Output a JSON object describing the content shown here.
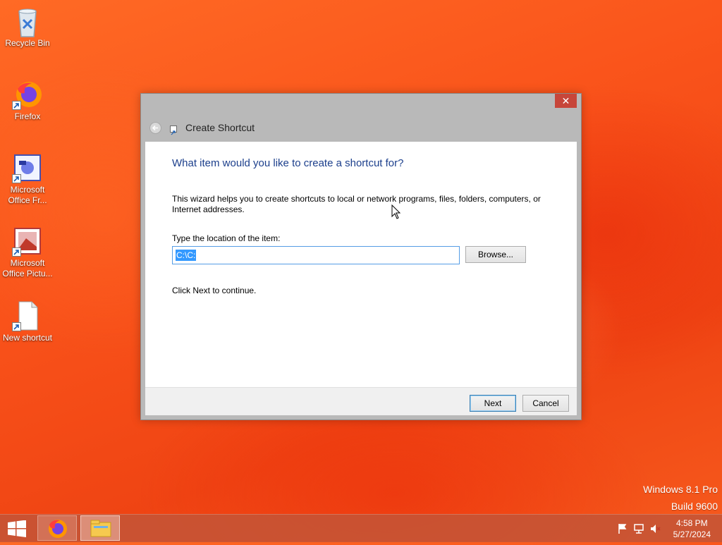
{
  "desktop": {
    "icons": [
      {
        "label": "Recycle Bin"
      },
      {
        "label": "Firefox"
      },
      {
        "label": "Microsoft Office Fr..."
      },
      {
        "label": "Microsoft Office Pictu..."
      },
      {
        "label": "New shortcut"
      }
    ]
  },
  "dialog": {
    "title": "Create Shortcut",
    "close_glyph": "✕",
    "heading": "What item would you like to create a shortcut for?",
    "description": "This wizard helps you to create shortcuts to local or network programs, files, folders, computers, or Internet addresses.",
    "location_label": "Type the location of the item:",
    "location_value": "C:\\C:",
    "browse_label": "Browse...",
    "continue_text": "Click Next to continue.",
    "next_label": "Next",
    "cancel_label": "Cancel"
  },
  "watermark": {
    "line1": "Windows 8.1 Pro",
    "line2": "Build 9600"
  },
  "taskbar": {
    "items": [
      "firefox-icon",
      "file-explorer-icon"
    ],
    "clock_time": "4:58 PM",
    "clock_date": "5/27/2024"
  },
  "colors": {
    "accent": "#1c3f8c",
    "close": "#c7463a",
    "selection": "#3399ff"
  }
}
